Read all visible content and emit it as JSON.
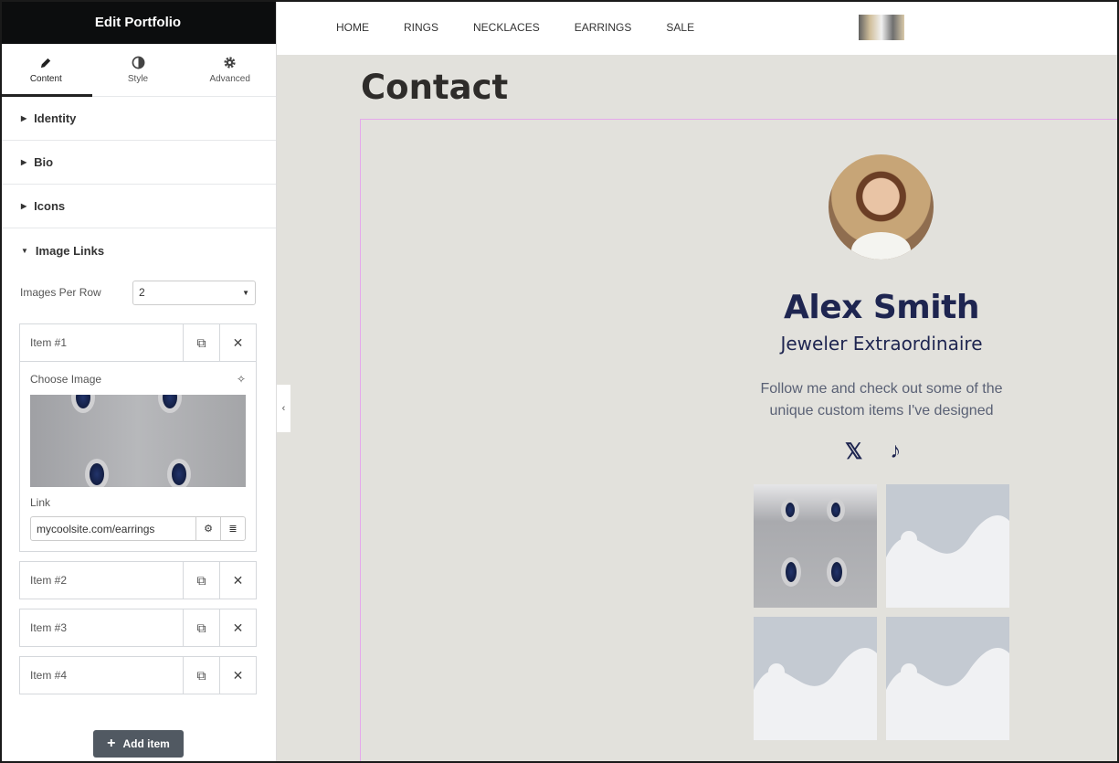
{
  "sidebar": {
    "title": "Edit Portfolio",
    "tabs": [
      {
        "label": "Content",
        "icon": "pencil-icon",
        "active": true
      },
      {
        "label": "Style",
        "icon": "contrast-icon"
      },
      {
        "label": "Advanced",
        "icon": "gear-icon"
      }
    ],
    "sections": [
      "Identity",
      "Bio",
      "Icons",
      "Image Links"
    ],
    "images_per_row": {
      "label": "Images Per Row",
      "value": "2"
    },
    "items": [
      {
        "label": "Item #1",
        "expanded": true,
        "choose_image": "Choose Image",
        "link_label": "Link",
        "link_value": "mycoolsite.com/earrings"
      },
      {
        "label": "Item #2"
      },
      {
        "label": "Item #3"
      },
      {
        "label": "Item #4"
      }
    ],
    "add_item": "Add item"
  },
  "preview": {
    "nav": [
      "HOME",
      "RINGS",
      "NECKLACES",
      "EARRINGS",
      "SALE"
    ],
    "heading": "Contact",
    "name": "Alex Smith",
    "job_title": "Jeweler Extraordinaire",
    "bio": "Follow me and check out some of the unique custom items I've designed",
    "socials": [
      {
        "icon": "x-twitter-icon",
        "glyph": "𝕏"
      },
      {
        "icon": "tiktok-icon",
        "glyph": "♪"
      }
    ],
    "name_color": "#1e2550",
    "background": "#e2e1dc"
  }
}
